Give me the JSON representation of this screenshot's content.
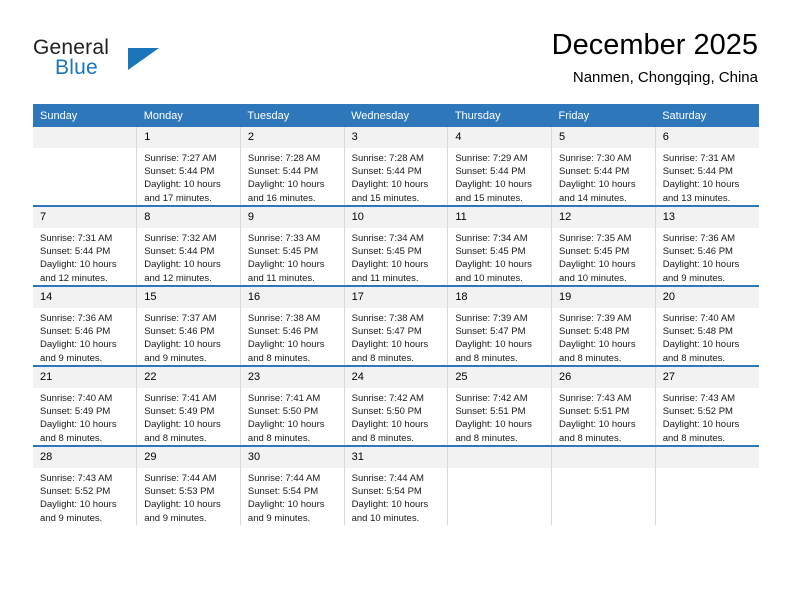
{
  "brand": {
    "name_primary": "General",
    "name_secondary": "Blue",
    "triangle_color": "#1b75bb",
    "primary_color": "#231f20"
  },
  "header": {
    "title": "December 2025",
    "subtitle": "Nanmen, Chongqing, China"
  },
  "theme": {
    "header_row_bg": "#2f77bb",
    "header_row_text": "#ffffff",
    "daynum_bg": "#f2f2f2",
    "row_separator": "#2f77bb",
    "column_separator": "#d9d9d9"
  },
  "weekday_headers": [
    "Sunday",
    "Monday",
    "Tuesday",
    "Wednesday",
    "Thursday",
    "Friday",
    "Saturday"
  ],
  "labels": {
    "sunrise_prefix": "Sunrise:",
    "sunset_prefix": "Sunset:",
    "daylight_prefix": "Daylight:"
  },
  "weeks": [
    [
      {
        "day": "",
        "blank": true,
        "line1": "",
        "line2": "",
        "line3": "",
        "line4": ""
      },
      {
        "day": "1",
        "line1": "Sunrise: 7:27 AM",
        "line2": "Sunset: 5:44 PM",
        "line3": "Daylight: 10 hours",
        "line4": "and 17 minutes."
      },
      {
        "day": "2",
        "line1": "Sunrise: 7:28 AM",
        "line2": "Sunset: 5:44 PM",
        "line3": "Daylight: 10 hours",
        "line4": "and 16 minutes."
      },
      {
        "day": "3",
        "line1": "Sunrise: 7:28 AM",
        "line2": "Sunset: 5:44 PM",
        "line3": "Daylight: 10 hours",
        "line4": "and 15 minutes."
      },
      {
        "day": "4",
        "line1": "Sunrise: 7:29 AM",
        "line2": "Sunset: 5:44 PM",
        "line3": "Daylight: 10 hours",
        "line4": "and 15 minutes."
      },
      {
        "day": "5",
        "line1": "Sunrise: 7:30 AM",
        "line2": "Sunset: 5:44 PM",
        "line3": "Daylight: 10 hours",
        "line4": "and 14 minutes."
      },
      {
        "day": "6",
        "line1": "Sunrise: 7:31 AM",
        "line2": "Sunset: 5:44 PM",
        "line3": "Daylight: 10 hours",
        "line4": "and 13 minutes."
      }
    ],
    [
      {
        "day": "7",
        "line1": "Sunrise: 7:31 AM",
        "line2": "Sunset: 5:44 PM",
        "line3": "Daylight: 10 hours",
        "line4": "and 12 minutes."
      },
      {
        "day": "8",
        "line1": "Sunrise: 7:32 AM",
        "line2": "Sunset: 5:44 PM",
        "line3": "Daylight: 10 hours",
        "line4": "and 12 minutes."
      },
      {
        "day": "9",
        "line1": "Sunrise: 7:33 AM",
        "line2": "Sunset: 5:45 PM",
        "line3": "Daylight: 10 hours",
        "line4": "and 11 minutes."
      },
      {
        "day": "10",
        "line1": "Sunrise: 7:34 AM",
        "line2": "Sunset: 5:45 PM",
        "line3": "Daylight: 10 hours",
        "line4": "and 11 minutes."
      },
      {
        "day": "11",
        "line1": "Sunrise: 7:34 AM",
        "line2": "Sunset: 5:45 PM",
        "line3": "Daylight: 10 hours",
        "line4": "and 10 minutes."
      },
      {
        "day": "12",
        "line1": "Sunrise: 7:35 AM",
        "line2": "Sunset: 5:45 PM",
        "line3": "Daylight: 10 hours",
        "line4": "and 10 minutes."
      },
      {
        "day": "13",
        "line1": "Sunrise: 7:36 AM",
        "line2": "Sunset: 5:46 PM",
        "line3": "Daylight: 10 hours",
        "line4": "and 9 minutes."
      }
    ],
    [
      {
        "day": "14",
        "line1": "Sunrise: 7:36 AM",
        "line2": "Sunset: 5:46 PM",
        "line3": "Daylight: 10 hours",
        "line4": "and 9 minutes."
      },
      {
        "day": "15",
        "line1": "Sunrise: 7:37 AM",
        "line2": "Sunset: 5:46 PM",
        "line3": "Daylight: 10 hours",
        "line4": "and 9 minutes."
      },
      {
        "day": "16",
        "line1": "Sunrise: 7:38 AM",
        "line2": "Sunset: 5:46 PM",
        "line3": "Daylight: 10 hours",
        "line4": "and 8 minutes."
      },
      {
        "day": "17",
        "line1": "Sunrise: 7:38 AM",
        "line2": "Sunset: 5:47 PM",
        "line3": "Daylight: 10 hours",
        "line4": "and 8 minutes."
      },
      {
        "day": "18",
        "line1": "Sunrise: 7:39 AM",
        "line2": "Sunset: 5:47 PM",
        "line3": "Daylight: 10 hours",
        "line4": "and 8 minutes."
      },
      {
        "day": "19",
        "line1": "Sunrise: 7:39 AM",
        "line2": "Sunset: 5:48 PM",
        "line3": "Daylight: 10 hours",
        "line4": "and 8 minutes."
      },
      {
        "day": "20",
        "line1": "Sunrise: 7:40 AM",
        "line2": "Sunset: 5:48 PM",
        "line3": "Daylight: 10 hours",
        "line4": "and 8 minutes."
      }
    ],
    [
      {
        "day": "21",
        "line1": "Sunrise: 7:40 AM",
        "line2": "Sunset: 5:49 PM",
        "line3": "Daylight: 10 hours",
        "line4": "and 8 minutes."
      },
      {
        "day": "22",
        "line1": "Sunrise: 7:41 AM",
        "line2": "Sunset: 5:49 PM",
        "line3": "Daylight: 10 hours",
        "line4": "and 8 minutes."
      },
      {
        "day": "23",
        "line1": "Sunrise: 7:41 AM",
        "line2": "Sunset: 5:50 PM",
        "line3": "Daylight: 10 hours",
        "line4": "and 8 minutes."
      },
      {
        "day": "24",
        "line1": "Sunrise: 7:42 AM",
        "line2": "Sunset: 5:50 PM",
        "line3": "Daylight: 10 hours",
        "line4": "and 8 minutes."
      },
      {
        "day": "25",
        "line1": "Sunrise: 7:42 AM",
        "line2": "Sunset: 5:51 PM",
        "line3": "Daylight: 10 hours",
        "line4": "and 8 minutes."
      },
      {
        "day": "26",
        "line1": "Sunrise: 7:43 AM",
        "line2": "Sunset: 5:51 PM",
        "line3": "Daylight: 10 hours",
        "line4": "and 8 minutes."
      },
      {
        "day": "27",
        "line1": "Sunrise: 7:43 AM",
        "line2": "Sunset: 5:52 PM",
        "line3": "Daylight: 10 hours",
        "line4": "and 8 minutes."
      }
    ],
    [
      {
        "day": "28",
        "line1": "Sunrise: 7:43 AM",
        "line2": "Sunset: 5:52 PM",
        "line3": "Daylight: 10 hours",
        "line4": "and 9 minutes."
      },
      {
        "day": "29",
        "line1": "Sunrise: 7:44 AM",
        "line2": "Sunset: 5:53 PM",
        "line3": "Daylight: 10 hours",
        "line4": "and 9 minutes."
      },
      {
        "day": "30",
        "line1": "Sunrise: 7:44 AM",
        "line2": "Sunset: 5:54 PM",
        "line3": "Daylight: 10 hours",
        "line4": "and 9 minutes."
      },
      {
        "day": "31",
        "line1": "Sunrise: 7:44 AM",
        "line2": "Sunset: 5:54 PM",
        "line3": "Daylight: 10 hours",
        "line4": "and 10 minutes."
      },
      {
        "day": "",
        "blank": true,
        "line1": "",
        "line2": "",
        "line3": "",
        "line4": ""
      },
      {
        "day": "",
        "blank": true,
        "line1": "",
        "line2": "",
        "line3": "",
        "line4": ""
      },
      {
        "day": "",
        "blank": true,
        "line1": "",
        "line2": "",
        "line3": "",
        "line4": ""
      }
    ]
  ]
}
